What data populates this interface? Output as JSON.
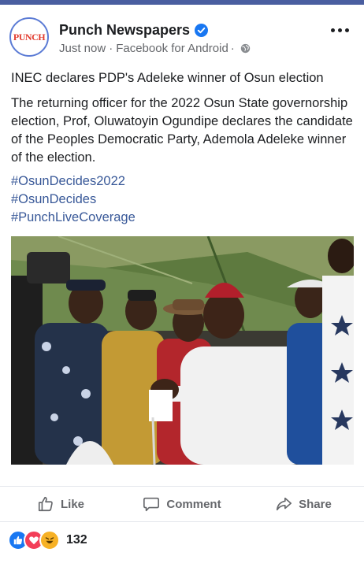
{
  "post": {
    "page_name": "Punch Newspapers",
    "avatar_text": "PUNCH",
    "time": "Just now",
    "separator": "·",
    "source": "Facebook for Android",
    "privacy_icon": "globe-icon",
    "headline": "INEC declares PDP's Adeleke winner of Osun election",
    "body": "The returning officer for the 2022 Osun State governorship election, Prof, Oluwatoyin Ogundipe declares the candidate of the Peoples Democratic Party, Ademola Adeleke winner of the election.",
    "hashtags": [
      "#OsunDecides2022",
      "#OsunDecides",
      "#PunchLiveCoverage"
    ]
  },
  "actions": {
    "like": "Like",
    "comment": "Comment",
    "share": "Share"
  },
  "reactions": {
    "types": [
      "like",
      "love",
      "haha"
    ],
    "count": "132"
  },
  "colors": {
    "brand_blue": "#1877f2",
    "hashtag": "#385898",
    "love_red": "#f33e58",
    "haha_yellow": "#f7b125"
  }
}
